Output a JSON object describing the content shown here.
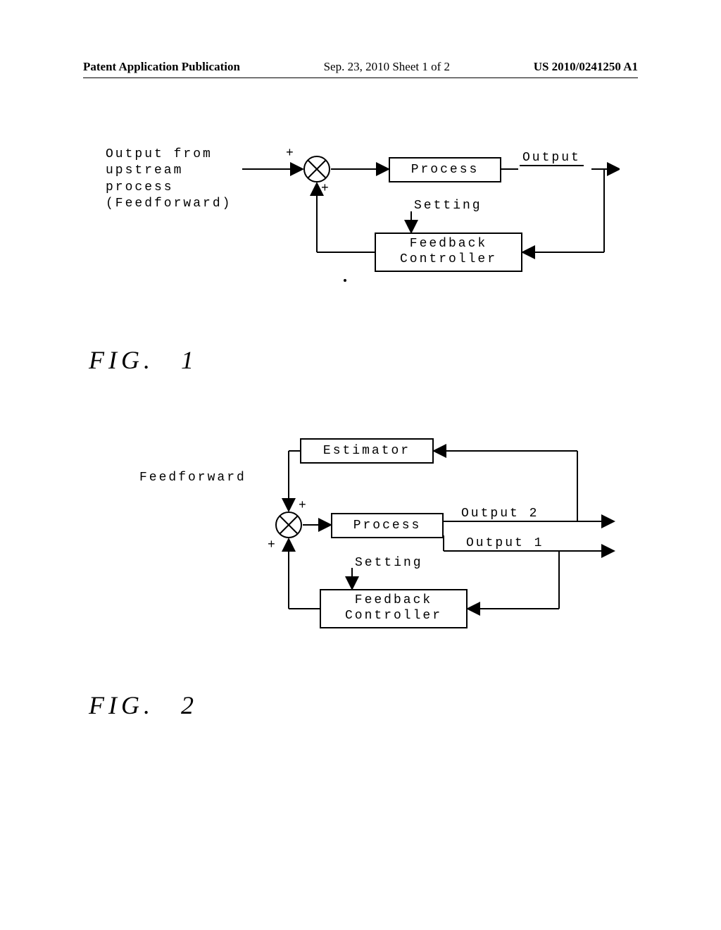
{
  "header": {
    "left": "Patent Application Publication",
    "center": "Sep. 23, 2010  Sheet 1 of 2",
    "right": "US 2010/0241250 A1"
  },
  "fig1": {
    "input_line1": "Output from",
    "input_line2": "upstream",
    "input_line3": "process",
    "input_line4": "(Feedforward)",
    "process": "Process",
    "output": "Output",
    "setting": "Setting",
    "feedback_line1": "Feedback",
    "feedback_line2": "Controller",
    "plus": "+",
    "label": "FIG.",
    "num": "1"
  },
  "fig2": {
    "feedforward": "Feedforward",
    "estimator": "Estimator",
    "process": "Process",
    "output1": "Output 1",
    "output2": "Output 2",
    "setting": "Setting",
    "feedback_line1": "Feedback",
    "feedback_line2": "Controller",
    "plus": "+",
    "label": "FIG.",
    "num": "2"
  }
}
